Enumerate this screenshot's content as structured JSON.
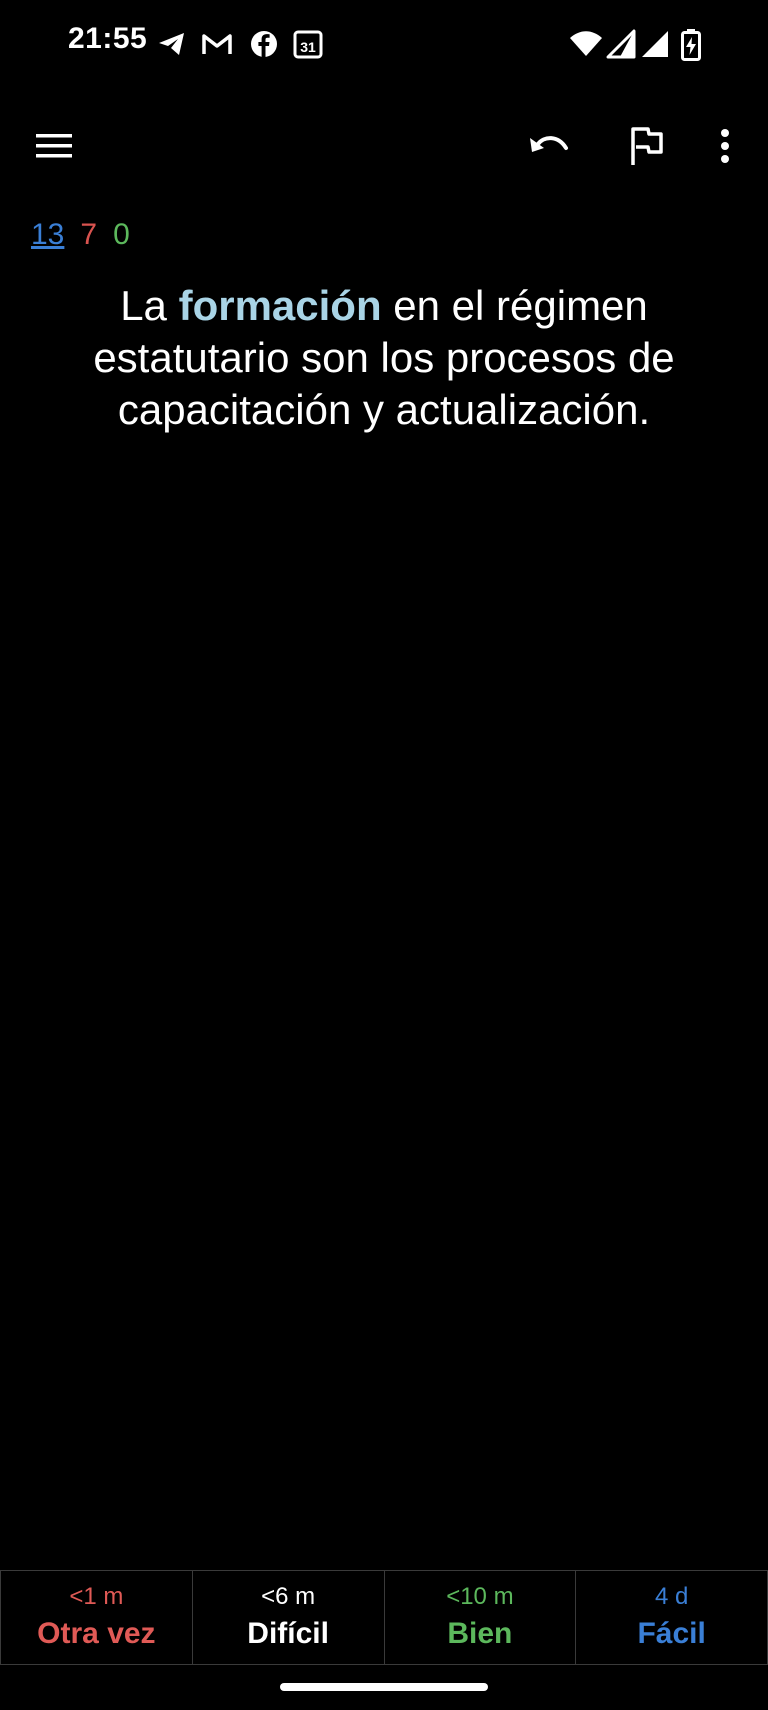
{
  "status_bar": {
    "time": "21:55",
    "notification_icons": [
      "telegram-icon",
      "gmail-icon",
      "facebook-icon",
      "calendar-icon"
    ],
    "calendar_day": "31",
    "system_icons": [
      "wifi-icon",
      "signal-icon",
      "signal-icon",
      "battery-charging-icon"
    ]
  },
  "toolbar": {
    "icons": [
      "menu-icon",
      "undo-icon",
      "flag-icon",
      "more-vert-icon"
    ]
  },
  "counts": {
    "new": "13",
    "learning": "7",
    "review": "0"
  },
  "card": {
    "before": "La ",
    "cloze": "formación",
    "after": " en el régimen estatutario son los procesos de capacitación y actualización."
  },
  "answer_buttons": [
    {
      "interval": "<1 m",
      "label": "Otra vez",
      "color": "#e05a56"
    },
    {
      "interval": "<6 m",
      "label": "Difícil",
      "color": "#ffffff"
    },
    {
      "interval": "<10 m",
      "label": "Bien",
      "color": "#5cb85c"
    },
    {
      "interval": "4 d",
      "label": "Fácil",
      "color": "#3a7fd6"
    }
  ],
  "colors": {
    "background": "#000000",
    "new_count": "#3a7fd6",
    "learning_count": "#d9534f",
    "review_count": "#5cb85c",
    "cloze": "#a9d4e6"
  }
}
